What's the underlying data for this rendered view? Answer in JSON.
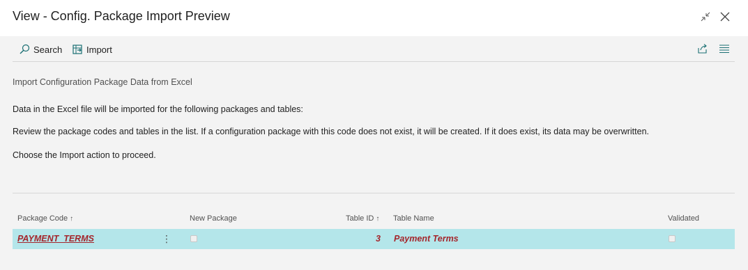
{
  "window": {
    "title": "View - Config. Package Import Preview"
  },
  "actions": {
    "search_label": "Search",
    "import_label": "Import"
  },
  "content": {
    "heading": "Import Configuration Package Data from Excel",
    "line1": "Data in the Excel file will be imported for the following packages and tables:",
    "line2": "Review the package codes and tables in the list. If a configuration package with this code does not exist, it will be created. If it does exist, its data may be overwritten.",
    "line3": "Choose the Import action to proceed."
  },
  "table": {
    "columns": {
      "package_code": "Package Code",
      "new_package": "New Package",
      "table_id": "Table ID",
      "table_name": "Table Name",
      "validated": "Validated"
    },
    "rows": [
      {
        "package_code": "PAYMENT_TERMS",
        "new_package": false,
        "table_id": "3",
        "table_name": "Payment Terms",
        "validated": false
      }
    ]
  },
  "colors": {
    "selected_row_bg": "#b4e6ea",
    "emphasis_text": "#a4262c"
  }
}
